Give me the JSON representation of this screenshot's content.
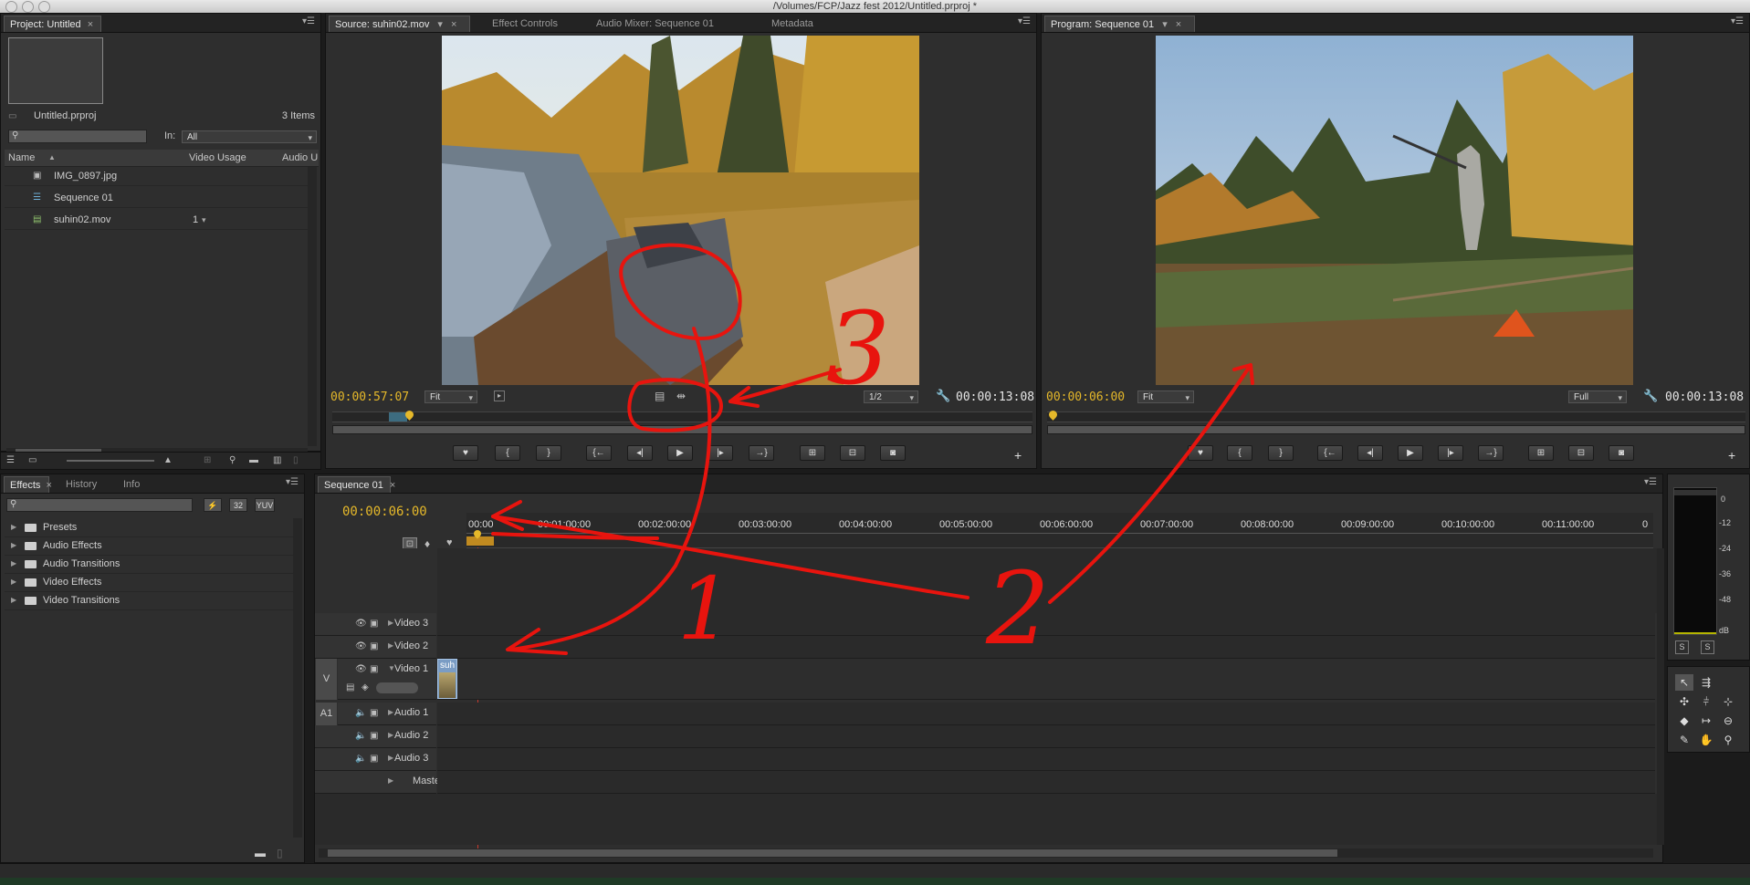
{
  "window": {
    "title": "/Volumes/FCP/Jazz fest 2012/Untitled.prproj *"
  },
  "project_panel": {
    "tab": "Project: Untitled",
    "file_name": "Untitled.prproj",
    "item_count": "3 Items",
    "search_placeholder": "",
    "in_label": "In:",
    "in_value": "All",
    "columns": [
      "Name",
      "Video Usage",
      "Audio U"
    ],
    "items": [
      {
        "name": "IMG_0897.jpg",
        "usage": ""
      },
      {
        "name": "Sequence 01",
        "usage": ""
      },
      {
        "name": "suhin02.mov",
        "usage": "1"
      }
    ]
  },
  "source_panel": {
    "tabs": [
      "Source: suhin02.mov",
      "Effect Controls",
      "Audio Mixer: Sequence 01",
      "Metadata"
    ],
    "timecode": "00:00:57:07",
    "duration": "00:00:13:08",
    "zoom": "Fit",
    "resolution": "1/2"
  },
  "program_panel": {
    "tab": "Program: Sequence 01",
    "timecode": "00:00:06:00",
    "duration": "00:00:13:08",
    "zoom": "Fit",
    "resolution": "Full"
  },
  "effects_panel": {
    "tabs": [
      "Effects",
      "History",
      "Info"
    ],
    "badges": [
      "32",
      "YUV"
    ],
    "folders": [
      "Presets",
      "Audio Effects",
      "Audio Transitions",
      "Video Effects",
      "Video Transitions"
    ]
  },
  "timeline": {
    "tab": "Sequence 01",
    "timecode": "00:00:06:00",
    "ruler_labels": [
      "00:00",
      "00:01:00:00",
      "00:02:00:00",
      "00:03:00:00",
      "00:04:00:00",
      "00:05:00:00",
      "00:06:00:00",
      "00:07:00:00",
      "00:08:00:00",
      "00:09:00:00",
      "00:10:00:00",
      "00:11:00:00",
      "0"
    ],
    "video_tracks": [
      "Video 3",
      "Video 2",
      "Video 1"
    ],
    "audio_tracks": [
      "Audio 1",
      "Audio 2",
      "Audio 3"
    ],
    "master": "Master",
    "v_target": "V",
    "a_target": "A1",
    "clip_label": "suh"
  },
  "audio_meter": {
    "scale": [
      "0",
      "-12",
      "-24",
      "-36",
      "-48",
      "dB"
    ],
    "solo": [
      "S",
      "S"
    ]
  },
  "annotations": [
    "1",
    "2",
    "3"
  ],
  "colors": {
    "timecode": "#e5b82a",
    "annotation": "#e8140e",
    "playhead": "#c63a2e"
  }
}
